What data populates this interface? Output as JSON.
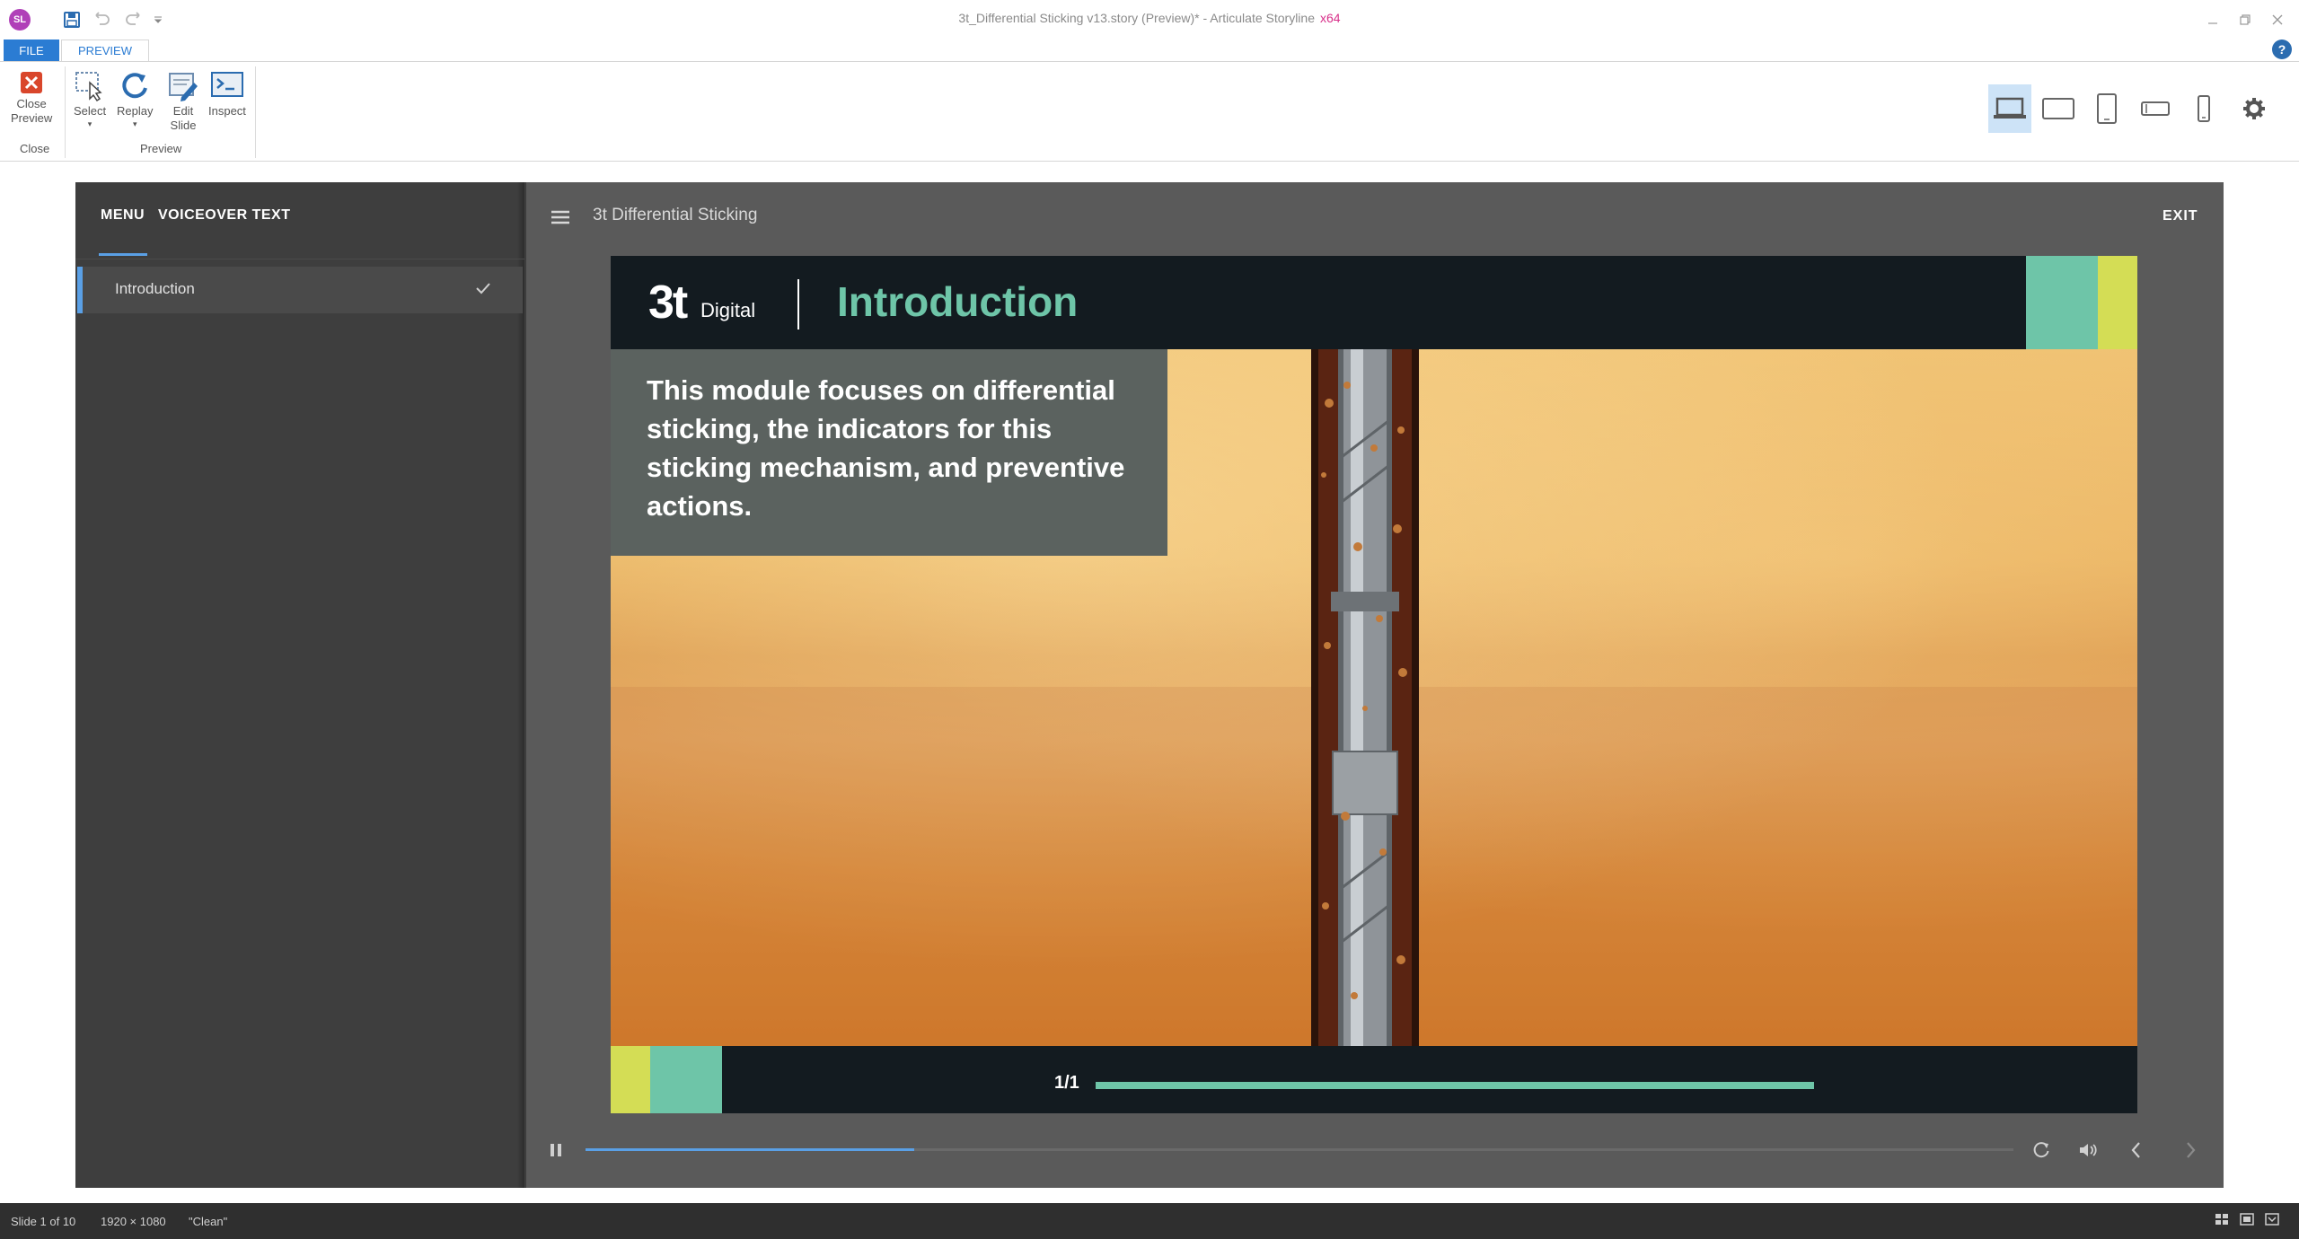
{
  "window": {
    "title": "3t_Differential Sticking v13.story (Preview)* - Articulate Storyline",
    "arch": "x64",
    "app_icon": "SL"
  },
  "ribbon": {
    "tabs": [
      {
        "label": "FILE"
      },
      {
        "label": "PREVIEW"
      }
    ],
    "close_preview": {
      "label_line1": "Close",
      "label_line2": "Preview",
      "icon": "close-x-icon"
    },
    "close_group": "Close",
    "select": {
      "label": "Select",
      "icon": "select-icon"
    },
    "replay": {
      "label": "Replay",
      "icon": "replay-icon"
    },
    "edit_slide": {
      "label_line1": "Edit",
      "label_line2": "Slide",
      "icon": "edit-slide-icon"
    },
    "inspect": {
      "label": "Inspect",
      "icon": "inspect-icon"
    },
    "preview_group": "Preview",
    "devices": [
      "desktop",
      "tablet-landscape",
      "tablet-portrait",
      "phone-landscape",
      "phone-portrait"
    ],
    "selected_device": "desktop"
  },
  "player": {
    "sidebar_tabs": {
      "menu": "MENU",
      "voiceover": "VOICEOVER TEXT"
    },
    "menu_items": [
      {
        "label": "Introduction",
        "completed": true
      }
    ],
    "course_title": "3t Differential Sticking",
    "exit_label": "EXIT",
    "seek_progress_pct": 23
  },
  "slide": {
    "logo_main": "3t",
    "logo_sub": "Digital",
    "title": "Introduction",
    "body": "This module focuses on differential sticking, the indicators for this sticking mechanism, and preventive actions.",
    "page_counter": "1/1",
    "slide_progress_pct": 100,
    "colors": {
      "header": "#131b20",
      "teal": "#6ec5a8",
      "yellow": "#d4dd55",
      "textbox": "#5b625f"
    }
  },
  "status": {
    "slide": "Slide 1 of 10",
    "size": "1920 × 1080",
    "theme": "\"Clean\""
  }
}
